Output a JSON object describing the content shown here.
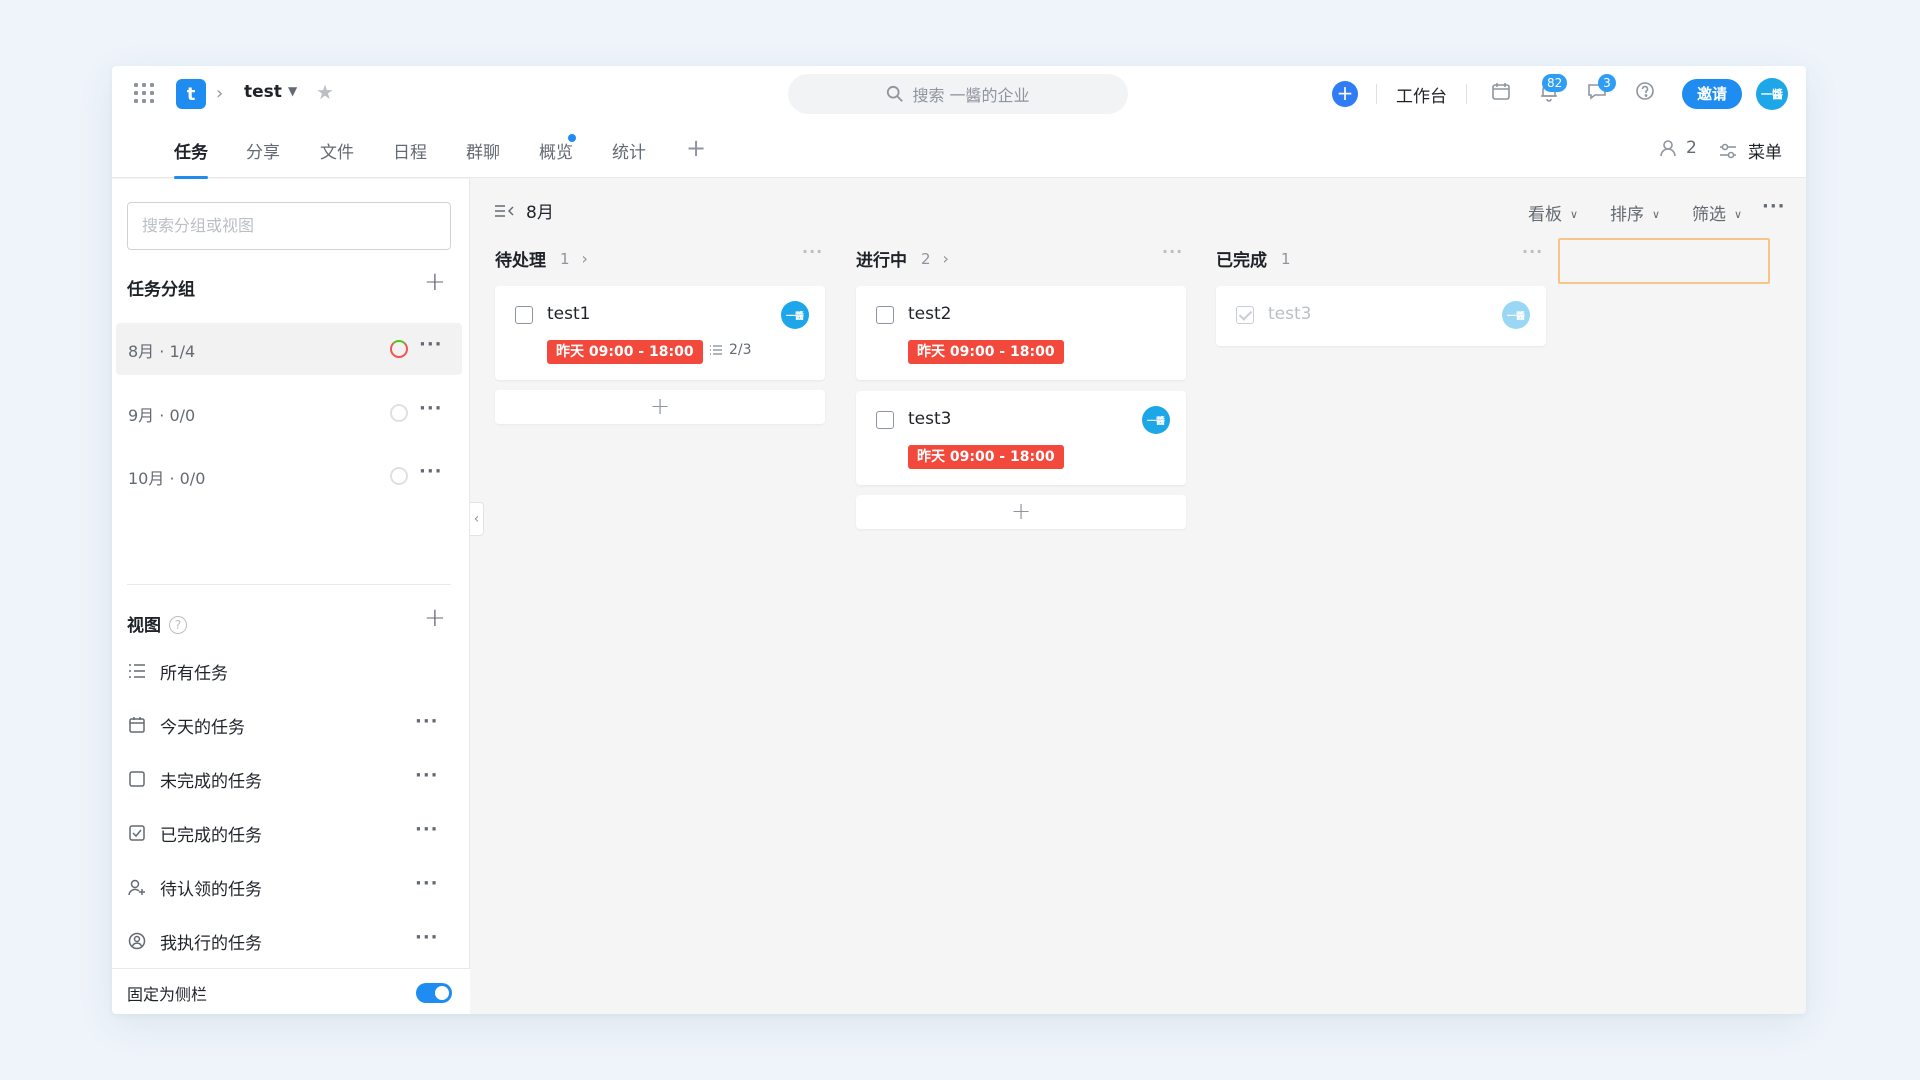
{
  "project": {
    "logo_letter": "t",
    "name": "test"
  },
  "search": {
    "placeholder": "搜索 一醬的企业"
  },
  "topbar": {
    "workbench": "工作台",
    "notifications_badge": "82",
    "messages_badge": "3",
    "invite": "邀请",
    "avatar_text": "一醬"
  },
  "tabs": [
    {
      "label": "任务",
      "active": true
    },
    {
      "label": "分享"
    },
    {
      "label": "文件"
    },
    {
      "label": "日程"
    },
    {
      "label": "群聊"
    },
    {
      "label": "概览",
      "dot": true
    },
    {
      "label": "统计"
    }
  ],
  "tabbar_right": {
    "members_count": "2",
    "menu": "菜单"
  },
  "sidebar": {
    "search_placeholder": "搜索分组或视图",
    "groups_title": "任务分组",
    "groups": [
      {
        "label": "8月 · 1/4",
        "active": true
      },
      {
        "label": "9月 · 0/0"
      },
      {
        "label": "10月 · 0/0"
      }
    ],
    "views_title": "视图",
    "views": [
      {
        "label": "所有任务",
        "icon": "list-icon"
      },
      {
        "label": "今天的任务",
        "icon": "calendar-icon"
      },
      {
        "label": "未完成的任务",
        "icon": "checkbox-empty-icon"
      },
      {
        "label": "已完成的任务",
        "icon": "checkbox-checked-icon"
      },
      {
        "label": "待认领的任务",
        "icon": "user-add-icon"
      },
      {
        "label": "我执行的任务",
        "icon": "user-circle-icon"
      }
    ],
    "pin_label": "固定为侧栏",
    "pin_enabled": true
  },
  "board": {
    "group_title": "8月",
    "tools": {
      "view": "看板",
      "sort": "排序",
      "filter": "筛选"
    },
    "columns": [
      {
        "title": "待处理",
        "count": "1",
        "cards": [
          {
            "title": "test1",
            "date": "昨天 09:00 - 18:00",
            "subtasks": "2/3",
            "avatar": "一醬"
          }
        ]
      },
      {
        "title": "进行中",
        "count": "2",
        "cards": [
          {
            "title": "test2",
            "date": "昨天 09:00 - 18:00"
          },
          {
            "title": "test3",
            "date": "昨天 09:00 - 18:00",
            "avatar": "一醬"
          }
        ]
      },
      {
        "title": "已完成",
        "count": "1",
        "cards": [
          {
            "title": "test3",
            "done": true,
            "avatar": "一醬"
          }
        ]
      }
    ]
  },
  "colors": {
    "accent": "#1e8cf0",
    "overdue": "#f2493c",
    "background": "#eef4fa"
  }
}
